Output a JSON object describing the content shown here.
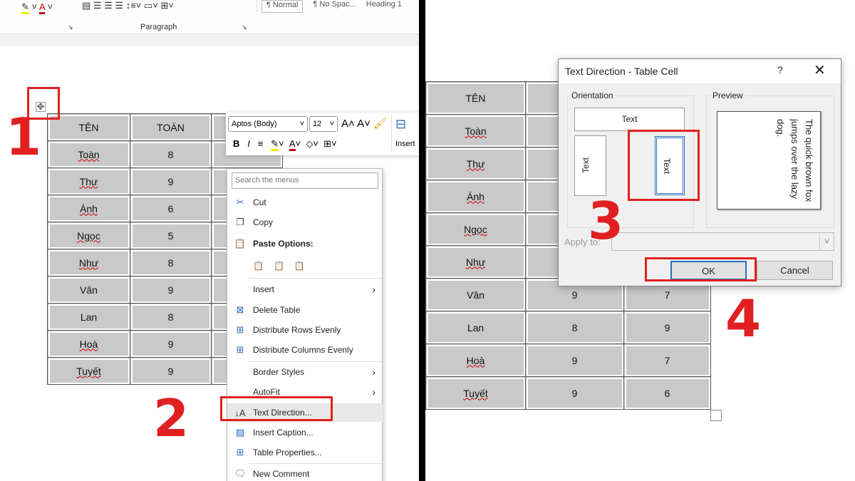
{
  "ribbon": {
    "group_label": "Paragraph",
    "styles": [
      "¶ Normal",
      "¶ No Spac...",
      "Heading 1"
    ]
  },
  "left_table": {
    "headers": [
      "TÊN",
      "TOÁN"
    ],
    "rows": [
      [
        "Toàn",
        "8"
      ],
      [
        "Thư",
        "9"
      ],
      [
        "Ánh",
        "6"
      ],
      [
        "Ngọc",
        "5"
      ],
      [
        "Như",
        "8"
      ],
      [
        "Vân",
        "9"
      ],
      [
        "Lan",
        "8"
      ],
      [
        "Hoà",
        "9"
      ],
      [
        "Tuyết",
        "9"
      ]
    ]
  },
  "mini_toolbar": {
    "font": "Aptos (Body)",
    "size": "12",
    "insert": "Insert"
  },
  "menu": {
    "search_placeholder": "Search the menus",
    "cut": "Cut",
    "copy": "Copy",
    "paste_options": "Paste Options:",
    "insert": "Insert",
    "delete_table": "Delete Table",
    "distribute_rows": "Distribute Rows Evenly",
    "distribute_cols": "Distribute Columns Evenly",
    "border_styles": "Border Styles",
    "autofit": "AutoFit",
    "text_direction": "Text Direction...",
    "insert_caption": "Insert Caption...",
    "table_properties": "Table Properties...",
    "new_comment": "New Comment"
  },
  "right_table": {
    "header": "TÊN",
    "rows": [
      [
        "Toàn",
        "",
        ""
      ],
      [
        "Thư",
        "",
        ""
      ],
      [
        "Ánh",
        "",
        ""
      ],
      [
        "Ngọc",
        "",
        ""
      ],
      [
        "Như",
        "",
        ""
      ],
      [
        "Vân",
        "9",
        "7"
      ],
      [
        "Lan",
        "8",
        "9"
      ],
      [
        "Hoà",
        "9",
        "7"
      ],
      [
        "Tuyết",
        "9",
        "6"
      ]
    ]
  },
  "dialog": {
    "title": "Text Direction - Table Cell",
    "help": "?",
    "orientation": "Orientation",
    "preview": "Preview",
    "option_text": "Text",
    "preview_text": "The quick brown fox jumps over the lazy dog.",
    "apply_to": "Apply to:",
    "ok": "OK",
    "cancel": "Cancel"
  },
  "steps": [
    "1",
    "2",
    "3",
    "4"
  ],
  "colors": {
    "annotation": "#e02020",
    "cell": "#c9c9c9"
  }
}
